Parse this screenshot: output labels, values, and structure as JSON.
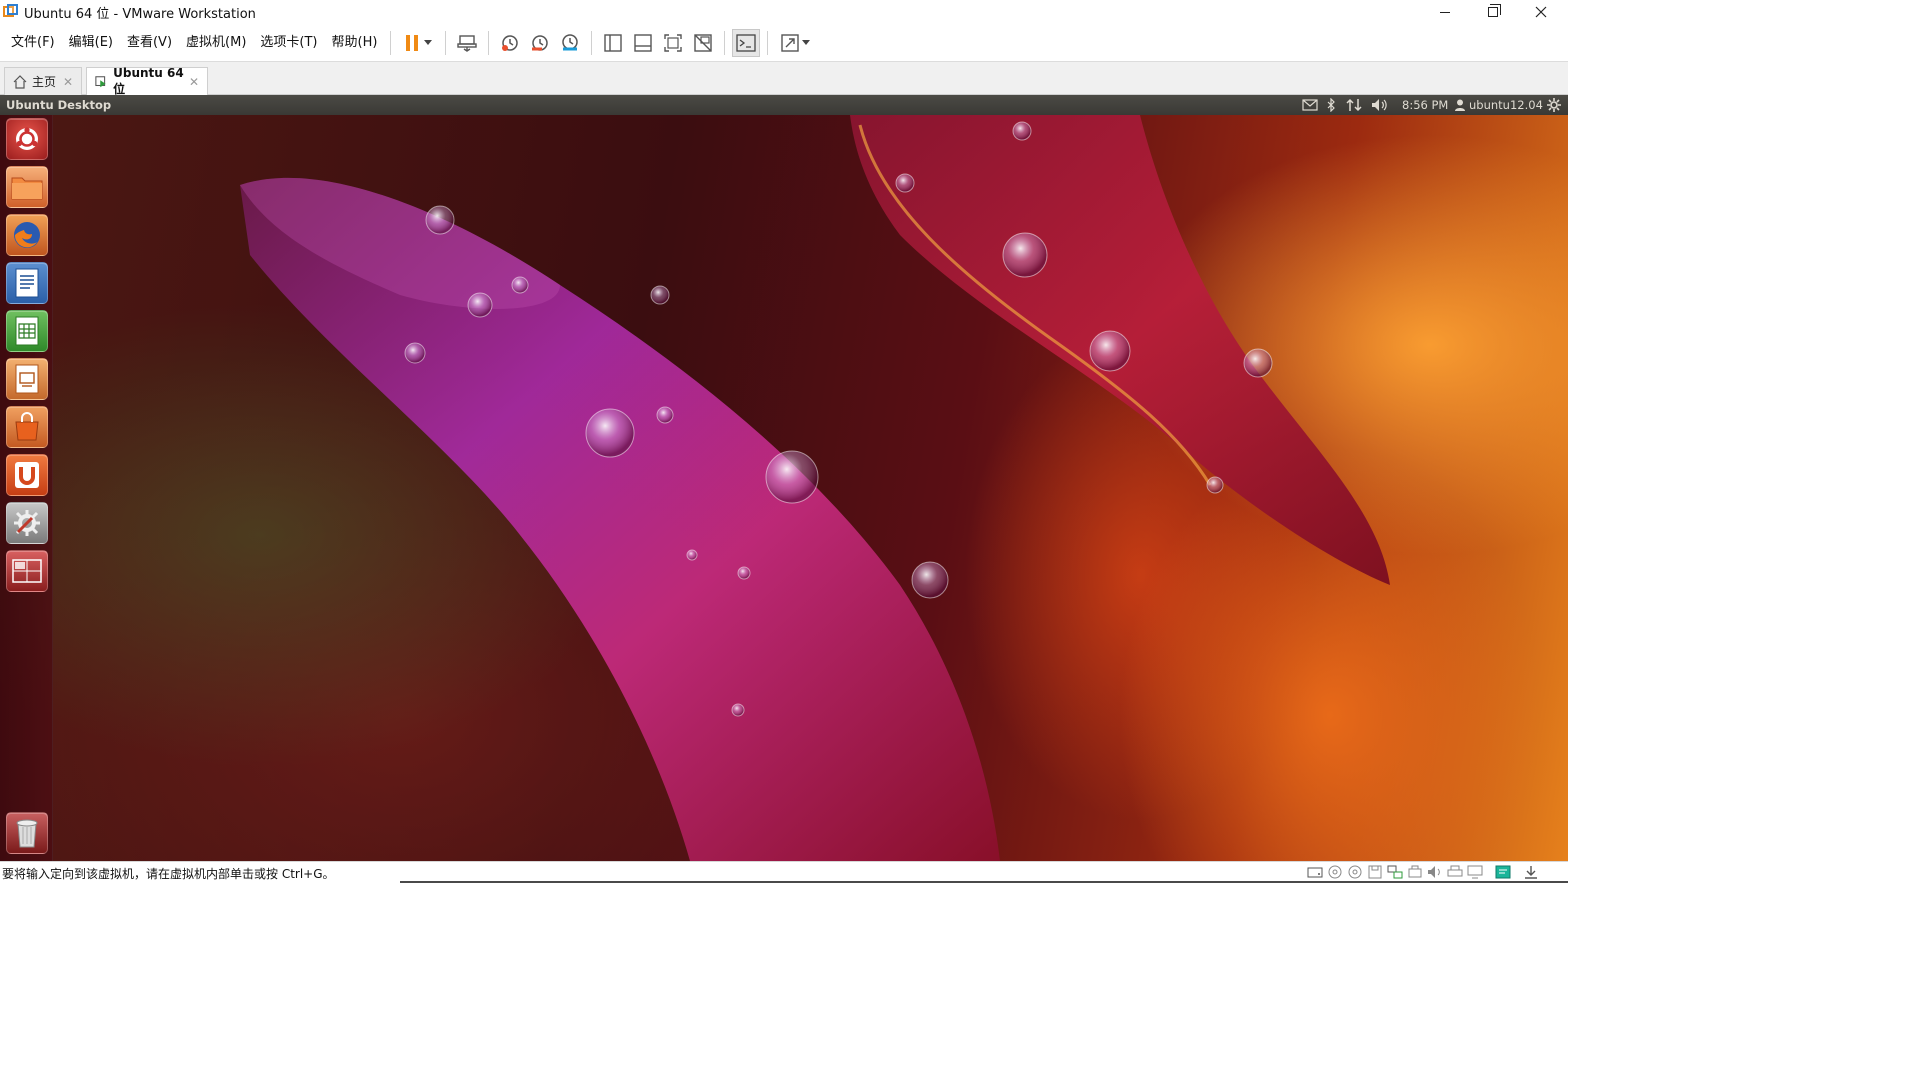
{
  "window": {
    "title": "Ubuntu 64 位 - VMware Workstation",
    "icon": "vmware-icon",
    "controls": [
      "minimize-icon",
      "restore-icon",
      "close-icon"
    ]
  },
  "menubar": {
    "items": [
      "文件(F)",
      "编辑(E)",
      "查看(V)",
      "虚拟机(M)",
      "选项卡(T)",
      "帮助(H)"
    ],
    "toolbar_icons": [
      "pause-icon",
      "send-ctrl-alt-del-icon",
      "snapshot-take-icon",
      "snapshot-revert-icon",
      "snapshot-manager-icon",
      "library-view-icon",
      "thumbnail-bar-icon",
      "full-screen-icon",
      "unity-icon",
      "console-view-icon",
      "stretch-guest-icon"
    ]
  },
  "tabs": [
    {
      "label": "主页",
      "icon": "home-icon"
    },
    {
      "label": "Ubuntu 64 位",
      "icon": "vm-tab-icon"
    }
  ],
  "guest": {
    "panel_title": "Ubuntu Desktop",
    "clock": "8:56 PM",
    "user": "ubuntu12.04",
    "indicators": [
      "mail-icon",
      "bluetooth-icon",
      "network-icon",
      "volume-icon",
      "user-icon",
      "settings-gear-icon"
    ],
    "launcher": [
      "dash-home-icon",
      "files-icon",
      "firefox-icon",
      "writer-icon",
      "calc-icon",
      "impress-icon",
      "software-center-icon",
      "ubuntu-one-icon",
      "system-settings-icon",
      "workspace-switcher-icon",
      "trash-icon"
    ]
  },
  "statusbar": {
    "message": "要将输入定向到该虚拟机，请在虚拟机内部单击或按 Ctrl+G。",
    "device_icons": [
      "hard-disk-icon",
      "cd-dvd-icon",
      "cd-dvd-icon-2",
      "floppy-icon",
      "network-adapter-icon",
      "usb-icon",
      "sound-icon",
      "printer-icon",
      "display-icon",
      "message-icon",
      "download-icon"
    ]
  }
}
